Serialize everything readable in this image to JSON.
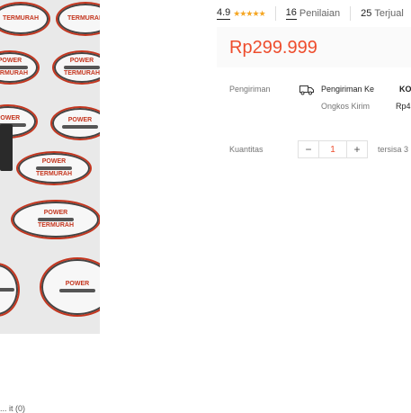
{
  "product_image": {
    "logo_line1": "POWER",
    "logo_line2": "TERMURAH"
  },
  "rating": {
    "score": "4.9",
    "stars": "★★★★★",
    "reviews_count": "16",
    "reviews_label": "Penilaian",
    "sold_count": "25",
    "sold_label": "Terjual"
  },
  "price": "Rp299.999",
  "shipping": {
    "label": "Pengiriman",
    "to_label": "Pengiriman Ke",
    "to_value": "KO",
    "cost_label": "Ongkos Kirim",
    "cost_value": "Rp4"
  },
  "quantity": {
    "label": "Kuantitas",
    "minus": "−",
    "value": "1",
    "plus": "+",
    "stock_text": "tersisa 3"
  },
  "bottom_hint": "... it (0)"
}
